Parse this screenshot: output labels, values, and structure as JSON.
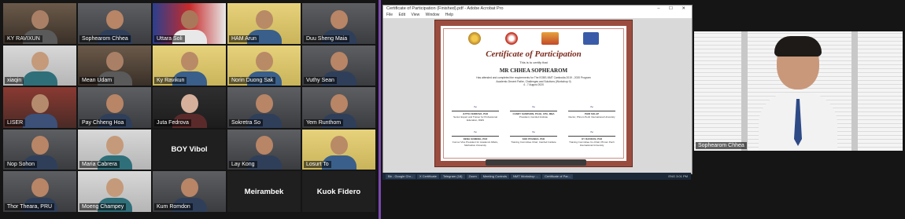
{
  "gallery": {
    "tiles": [
      {
        "name": "KY RAVIXUN",
        "style": "room"
      },
      {
        "name": "Sophearom Chhea",
        "style": "person"
      },
      {
        "name": "Uttara Soli",
        "style": "person-flag"
      },
      {
        "name": "HAM Arun",
        "style": "person-yellow"
      },
      {
        "name": "Duu Sheng Maia",
        "style": "person"
      },
      {
        "name": "xiaqin",
        "style": "person-light"
      },
      {
        "name": "Mean Udam",
        "style": "room"
      },
      {
        "name": "Ky Ravikun",
        "style": "person-yellow"
      },
      {
        "name": "Norin Duong Sak",
        "style": "person-yellow"
      },
      {
        "name": "Vuthy Sean",
        "style": "person"
      },
      {
        "name": "LISER",
        "style": "room-red"
      },
      {
        "name": "Pay Chheng Hoa",
        "style": "person"
      },
      {
        "name": "Juta Fedrova",
        "style": "person-dark"
      },
      {
        "name": "Sokretra So",
        "style": "person"
      },
      {
        "name": "Yem Runthom",
        "style": "person"
      },
      {
        "name": "Nop Sohon",
        "style": "person"
      },
      {
        "name": "Maria Cabrera",
        "style": "person-light"
      },
      {
        "name": "BOY Vibol",
        "style": "text"
      },
      {
        "name": "Lay Kong",
        "style": "person"
      },
      {
        "name": "Losurt To",
        "style": "person-yellow"
      },
      {
        "name": "Thor Theara, PRU",
        "style": "person"
      },
      {
        "name": "Moeng Champey",
        "style": "person-light"
      },
      {
        "name": "Kum Romdon",
        "style": "person"
      },
      {
        "name": "Meirambek",
        "style": "text"
      },
      {
        "name": "Kuok Fidero",
        "style": "text"
      }
    ]
  },
  "acrobat": {
    "title": "Certificate of Participation (Finished).pdf - Adobe Acrobat Pro",
    "menu": [
      "File",
      "Edit",
      "View",
      "Window",
      "Help"
    ],
    "window_buttons": "– ☐ ✕"
  },
  "certificate": {
    "title": "Certificate of Participation",
    "certify": "This is to certify that",
    "recipient": "MR CHHEA SOPHEAROM",
    "body_line1": "Has attended and completed the requirements for The EOBS-NMT Cambodia 2019 - 2020 Program",
    "body_line2": "Academic Decent Pathe, Challenges and Solutions (Workshop II)",
    "body_line3": "4 - 7 August 2020",
    "logos": [
      "Camfed",
      "CVET",
      "NMT",
      "DIES"
    ],
    "signatures_row1": [
      {
        "name": "JUTTA FEDROVA, PhD",
        "role": "Senior Expert and Trainer for Professional Education, DIES"
      },
      {
        "name": "CANDY SAMPHON, PCAE, CPA, MBA",
        "role": "President, Camfed Institute"
      },
      {
        "name": "PHIR SOLAP",
        "role": "Rector, Phnom Penh International University"
      }
    ],
    "signatures_row2": [
      {
        "name": "DENG SOMENG, PhD",
        "role": "Former Vice President for Academic Affairs, Methodius University"
      },
      {
        "name": "KOK PIVANDA, PhD",
        "role": "Training Committee Chair, Camfed Institute"
      },
      {
        "name": "KY RAVIKUN, PhD",
        "role": "Training Committee Co-Chair, Phnom Penh International University"
      }
    ]
  },
  "taskbar": {
    "items": [
      "Bb - Google Chr...",
      "X Certificate",
      "Telegram (18)",
      "Zoom",
      "Meeting Controls",
      "NMT Workshop ...",
      "Certificate of Par..."
    ],
    "tray": "ENG 3:01 PM"
  },
  "speaker": {
    "name": "Sophearom Chhea"
  },
  "colors": {
    "accent": "#7a4ab0",
    "certificate_border": "#9a4d3f",
    "certificate_title": "#7b2a1d"
  }
}
